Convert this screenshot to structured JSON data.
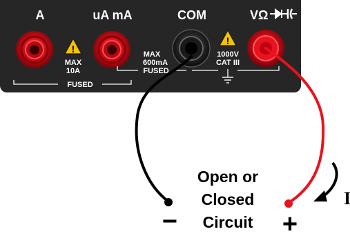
{
  "meter": {
    "terminals": {
      "a": "A",
      "ua_ma": "uA mA",
      "com": "COM",
      "volt_ohm": "VΩ",
      "diode_cap": "▸┤ ┤├"
    },
    "warnings": {
      "a_rating_line1": "MAX",
      "a_rating_line2": "10A",
      "ma_rating_line1": "MAX",
      "ma_rating_line2": "600mA",
      "v_rating_line1": "1000V",
      "v_rating_line2": "CAT III"
    },
    "fused_labels": {
      "left": "FUSED",
      "right": "FUSED"
    }
  },
  "circuit": {
    "label_line1": "Open or",
    "label_line2": "Closed",
    "label_line3": "Circuit",
    "minus_sign": "−",
    "plus_sign": "+",
    "current_label": "I"
  },
  "colors": {
    "panel": "#262626",
    "jack_red": "#e8131c",
    "jack_black": "#1a1a1a",
    "lead_red": "#e8131c",
    "lead_black": "#000000",
    "warning_yellow": "#f5c400",
    "panel_edge_blue": "#2f6fb5"
  }
}
